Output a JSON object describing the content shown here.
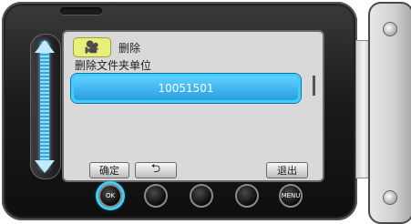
{
  "screen": {
    "mode_icon": "🎥",
    "title": "删除",
    "subtitle": "删除文件夹单位",
    "selected_item": "10051501",
    "buttons": {
      "confirm": "确定",
      "back": "⮌",
      "exit": "退出"
    }
  },
  "hardware": {
    "ok_button": "OK",
    "menu_button": "MENU"
  }
}
